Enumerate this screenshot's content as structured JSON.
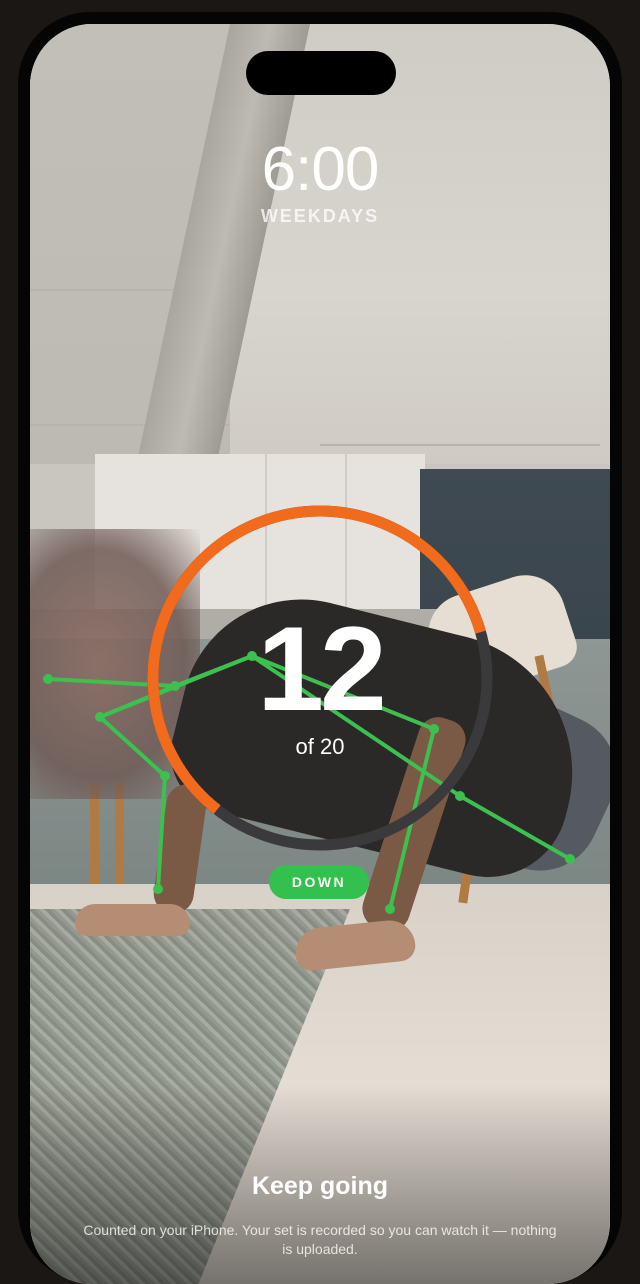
{
  "alarm": {
    "time": "6:00",
    "schedule": "WEEKDAYS"
  },
  "counter": {
    "count": "12",
    "of_total": "of 20",
    "progress": 0.6
  },
  "phase_badge": "DOWN",
  "footer": {
    "title": "Keep going",
    "note": "Counted on your iPhone. Your set is recorded so you can watch it — nothing is uploaded."
  },
  "colors": {
    "ring_progress": "#f26a1b",
    "ring_track": "#3a3a3c",
    "skeleton": "#3cc04f",
    "badge": "#34c04e"
  }
}
